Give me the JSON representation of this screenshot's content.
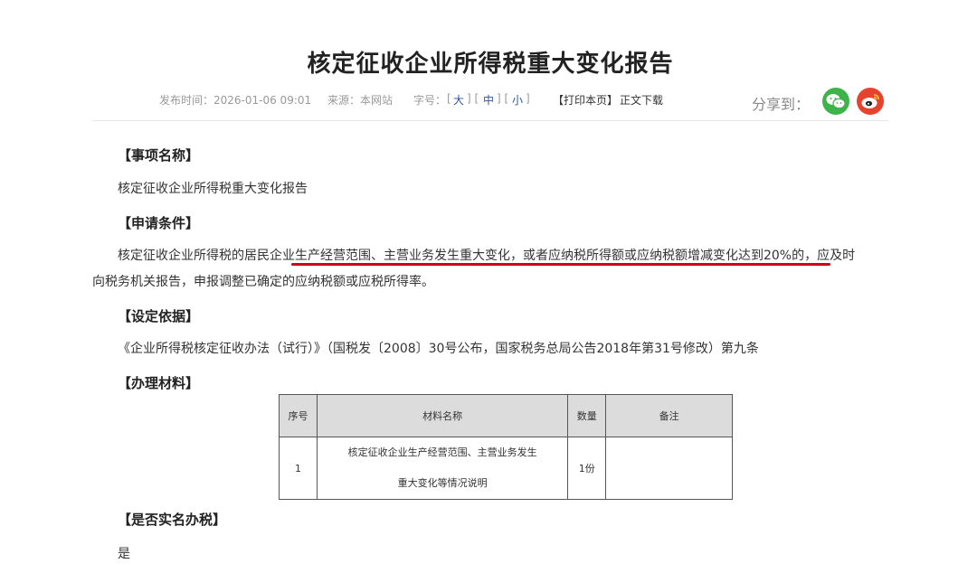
{
  "article": {
    "title": "核定征收企业所得税重大变化报告",
    "meta": {
      "publish_time": "发布时间：2026-01-06 09:01",
      "source": "来源：本网站",
      "font_size_label": "字号：",
      "bracket_open": "[",
      "bracket_close": "]",
      "bracket_sep": "] [",
      "size_large": "大",
      "size_medium": "中",
      "size_small": "小",
      "print": "【打印本页】",
      "download": "正文下载"
    },
    "share": {
      "label": "分享到："
    }
  },
  "sections": {
    "item_name": {
      "heading": "【事项名称】",
      "text": "核定征收企业所得税重大变化报告"
    },
    "conditions": {
      "heading": "【申请条件】",
      "line1": "核定征收企业所得税的居民企业生产经营范围、主营业务发生重大变化，或者应纳税所得额或应纳税额增减变化达到20%的，应及时",
      "line2": "向税务机关报告，申报调整已确定的应纳税额或应税所得率。"
    },
    "basis": {
      "heading": "【设定依据】",
      "text": "《企业所得税核定征收办法（试行）》（国税发〔2008〕30号公布，国家税务总局公告2018年第31号修改）第九条"
    },
    "materials": {
      "heading": "【办理材料】",
      "columns": [
        "序号",
        "材料名称",
        "数量",
        "备注"
      ],
      "rows": [
        {
          "index": "1",
          "name_line1": "核定征收企业生产经营范围、主营业务发生",
          "name_line2": "重大变化等情况说明",
          "quantity": "1份",
          "note": ""
        }
      ]
    },
    "realname": {
      "heading": "【是否实名办税】",
      "text": "是"
    }
  },
  "colors": {
    "accent_link": "#2f5597",
    "highlight_underline": "#d0021b",
    "wechat": "#3db34a",
    "weibo": "#e6432e"
  },
  "icons": {
    "wechat": "wechat-icon",
    "weibo": "weibo-icon"
  }
}
